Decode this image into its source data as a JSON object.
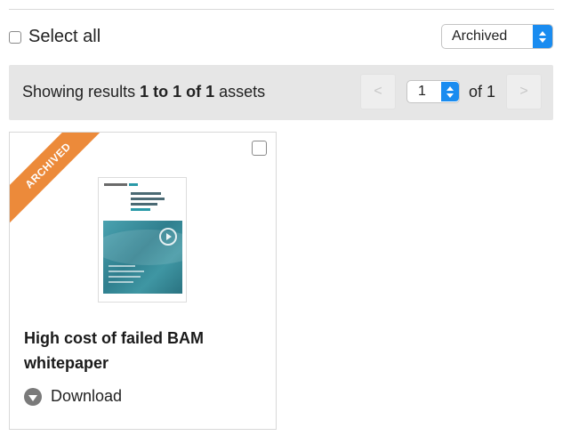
{
  "toolbar": {
    "select_all_label": "Select all",
    "filter_value": "Archived"
  },
  "results": {
    "prefix": "Showing results ",
    "range": "1 to 1 of 1",
    "suffix": " assets",
    "current_page": "1",
    "of_label": "of 1",
    "prev_glyph": "<",
    "next_glyph": ">"
  },
  "asset": {
    "badge": "ARCHIVED",
    "title": "High cost of failed BAM whitepaper",
    "download_label": "Download"
  },
  "colors": {
    "accent": "#1a8cf0",
    "badge": "#ec8a3a",
    "bar_bg": "#e6e6e6"
  }
}
